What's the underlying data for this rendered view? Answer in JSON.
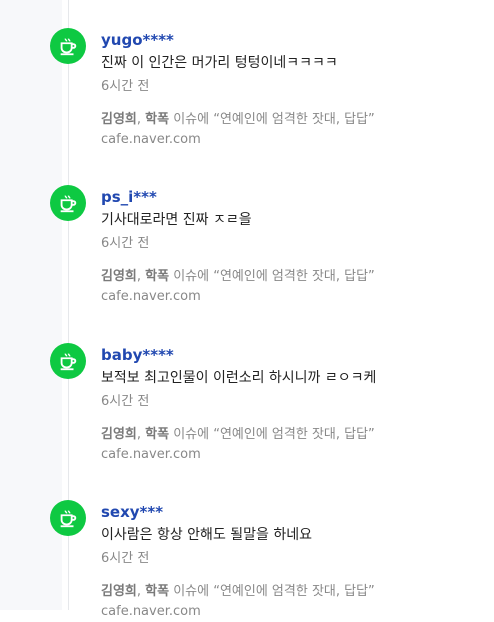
{
  "comments": [
    {
      "author": "yugo****",
      "text": "진짜 이 인간은 머가리 텅텅이네ㅋㅋㅋㅋ",
      "time": "6시간 전",
      "source_name1": "김영희",
      "source_sep": ", ",
      "source_name2": "학폭",
      "source_title": " 이슈에 “연예인에 엄격한 잣대, 답답”",
      "source_domain": "cafe.naver.com"
    },
    {
      "author": "ps_i***",
      "text": "기사대로라면 진짜 ㅈㄹ을",
      "time": "6시간 전",
      "source_name1": "김영희",
      "source_sep": ", ",
      "source_name2": "학폭",
      "source_title": " 이슈에 “연예인에 엄격한 잣대, 답답”",
      "source_domain": "cafe.naver.com"
    },
    {
      "author": "baby****",
      "text": "보적보 최고인물이 이런소리 하시니까 ㄹㅇㅋ케",
      "time": "6시간 전",
      "source_name1": "김영희",
      "source_sep": ", ",
      "source_name2": "학폭",
      "source_title": " 이슈에 “연예인에 엄격한 잣대, 답답”",
      "source_domain": "cafe.naver.com"
    },
    {
      "author": "sexy***",
      "text": "이사람은 항상 안해도 될말을 하네요",
      "time": "6시간 전",
      "source_name1": "김영희",
      "source_sep": ", ",
      "source_name2": "학폭",
      "source_title": " 이슈에 “연예인에 엄격한 잣대, 답답”",
      "source_domain": "cafe.naver.com"
    }
  ],
  "avatar_icon": "coffee-cup-icon",
  "colors": {
    "avatar": "#0ec942",
    "author": "#2148b0",
    "text": "#222222",
    "meta": "#888888"
  }
}
